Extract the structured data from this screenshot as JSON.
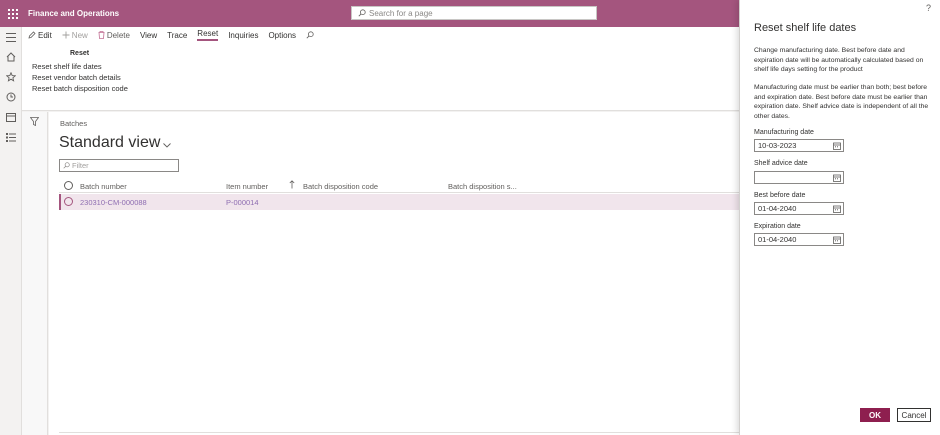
{
  "app": {
    "title": "Finance and Operations"
  },
  "search": {
    "placeholder": "Search for a page"
  },
  "actions": {
    "edit": "Edit",
    "new": "New",
    "delete": "Delete",
    "view": "View",
    "trace": "Trace",
    "reset": "Reset",
    "inquiries": "Inquiries",
    "options": "Options"
  },
  "reset_group": {
    "title": "Reset",
    "links": [
      "Reset shelf life dates",
      "Reset vendor batch details",
      "Reset batch disposition code"
    ]
  },
  "page": {
    "section": "Batches",
    "view_name": "Standard view",
    "filter_placeholder": "Filter"
  },
  "grid": {
    "columns": [
      "Batch number",
      "Item number",
      "Batch disposition code",
      "Batch disposition s..."
    ],
    "rows": [
      {
        "batch_number": "230310-CM-000088",
        "item_number": "P-000014",
        "disposition_code": "",
        "disposition_status": ""
      }
    ]
  },
  "dialog": {
    "help": "?",
    "title": "Reset shelf life dates",
    "info1": "Change manufacturing date. Best before date and expiration date will be automatically calculated based on shelf life days setting for the product",
    "info2": "Manufacturing date must be earlier than both; best before and expiration date. Best before date must be earlier than expiration date. Shelf advice date is independent of all the other dates.",
    "fields": {
      "manufacturing": {
        "label": "Manufacturing date",
        "value": "10-03-2023"
      },
      "shelf_advice": {
        "label": "Shelf advice date",
        "value": ""
      },
      "best_before": {
        "label": "Best before date",
        "value": "01-04-2040"
      },
      "expiration": {
        "label": "Expiration date",
        "value": "01-04-2040"
      }
    },
    "ok": "OK",
    "cancel": "Cancel"
  },
  "colors": {
    "brand": "#a4557e",
    "ok_button": "#8e1f4f",
    "selected_row": "#f1e5ec",
    "link": "#8e6db1"
  }
}
